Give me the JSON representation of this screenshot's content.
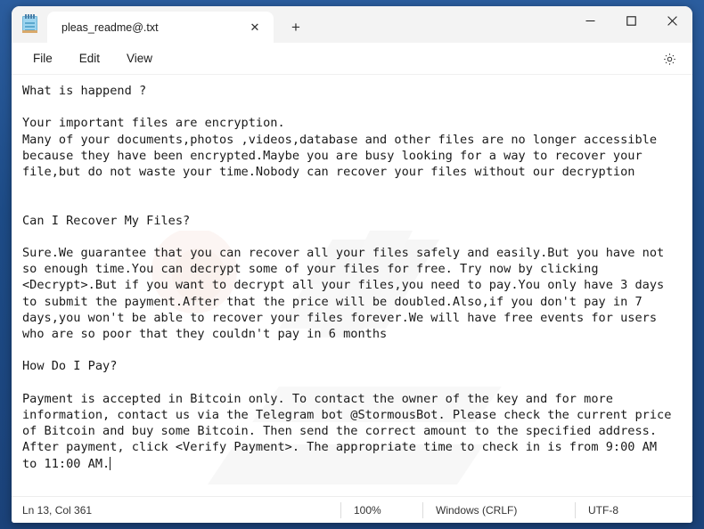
{
  "window": {
    "app_icon": "notepad-icon",
    "controls": {
      "minimize": "minimize-icon",
      "maximize": "maximize-icon",
      "close": "close-icon"
    }
  },
  "tabs": [
    {
      "title": "pleas_readme@.txt",
      "close_label": "✕",
      "active": true
    }
  ],
  "new_tab_label": "+",
  "menu": {
    "items": [
      {
        "label": "File"
      },
      {
        "label": "Edit"
      },
      {
        "label": "View"
      }
    ],
    "settings_icon": "gear-icon"
  },
  "document": {
    "filename": "pleas_readme@.txt",
    "body": "What is happend ?\n\nYour important files are encryption.\nMany of your documents,photos ,videos,database and other files are no longer accessible\nbecause they have been encrypted.Maybe you are busy looking for a way to recover your\nfile,but do not waste your time.Nobody can recover your files without our decryption\n\n\nCan I Recover My Files?\n\nSure.We guarantee that you can recover all your files safely and easily.But you have not\nso enough time.You can decrypt some of your files for free. Try now by clicking\n<Decrypt>.But if you want to decrypt all your files,you need to pay.You only have 3 days\nto submit the payment.After that the price will be doubled.Also,if you don't pay in 7\ndays,you won't be able to recover your files forever.We will have free events for users\nwho are so poor that they couldn't pay in 6 months\n\nHow Do I Pay?\n\nPayment is accepted in Bitcoin only. To contact the owner of the key and for more\ninformation, contact us via the Telegram bot @StormousBot. Please check the current price\nof Bitcoin and buy some Bitcoin. Then send the correct amount to the specified address.\nAfter payment, click <Verify Payment>. The appropriate time to check in is from 9:00 AM\nto 11:00 AM."
  },
  "statusbar": {
    "position": "Ln 13, Col 361",
    "zoom": "100%",
    "line_ending": "Windows (CRLF)",
    "encoding": "UTF-8"
  },
  "colors": {
    "desktop": "#1f4e8c",
    "window_bg": "#ffffff",
    "titlebar_bg": "#f3f3f3",
    "text": "#1a1a1a",
    "status_text": "#333333"
  }
}
